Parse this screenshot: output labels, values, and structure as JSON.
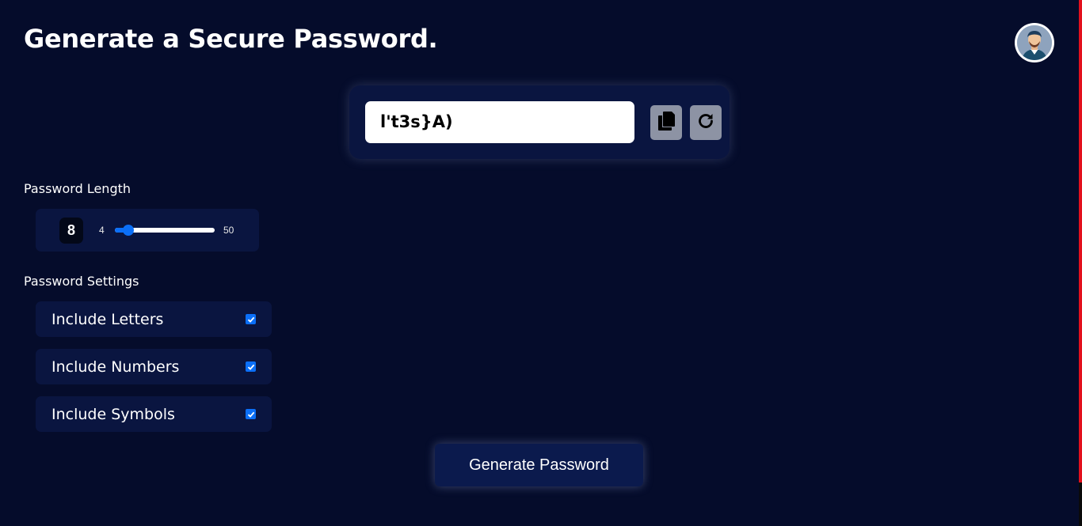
{
  "page": {
    "title": "Generate a Secure Password."
  },
  "password": {
    "value": "l't3s}A)"
  },
  "icons": {
    "copy": "copy-icon",
    "regenerate": "refresh-icon",
    "avatar": "user-avatar"
  },
  "length": {
    "label": "Password Length",
    "value": "8",
    "min": "4",
    "max": "50",
    "current": 8
  },
  "settings": {
    "label": "Password Settings",
    "items": [
      {
        "label": "Include Letters",
        "checked": true
      },
      {
        "label": "Include Numbers",
        "checked": true
      },
      {
        "label": "Include Symbols",
        "checked": true
      }
    ]
  },
  "actions": {
    "generate_label": "Generate Password"
  },
  "colors": {
    "background": "#050c2b",
    "card": "#0a1540",
    "accent": "#0b6ff7",
    "scroll_edge": "#e3101d"
  }
}
